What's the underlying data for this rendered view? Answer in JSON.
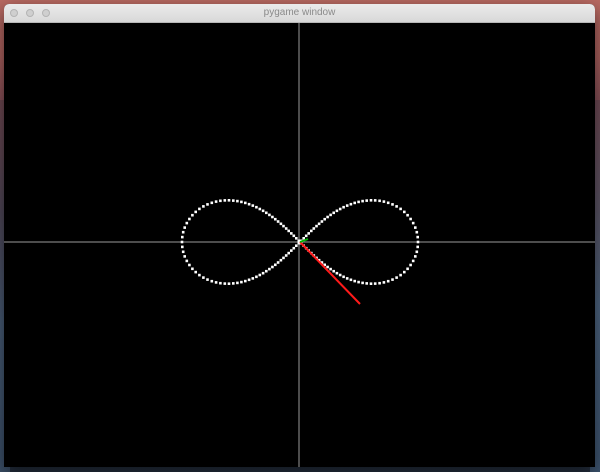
{
  "window": {
    "title": "pygame window"
  },
  "scene": {
    "background_color": "#000000",
    "axis_color": "#9a9a9a",
    "curve_color": "#ffffff",
    "curve_shape": "lemniscate (infinity loop) traced with dots",
    "red_vector_color": "#ff1a1a",
    "green_vector_color": "#00b400"
  }
}
